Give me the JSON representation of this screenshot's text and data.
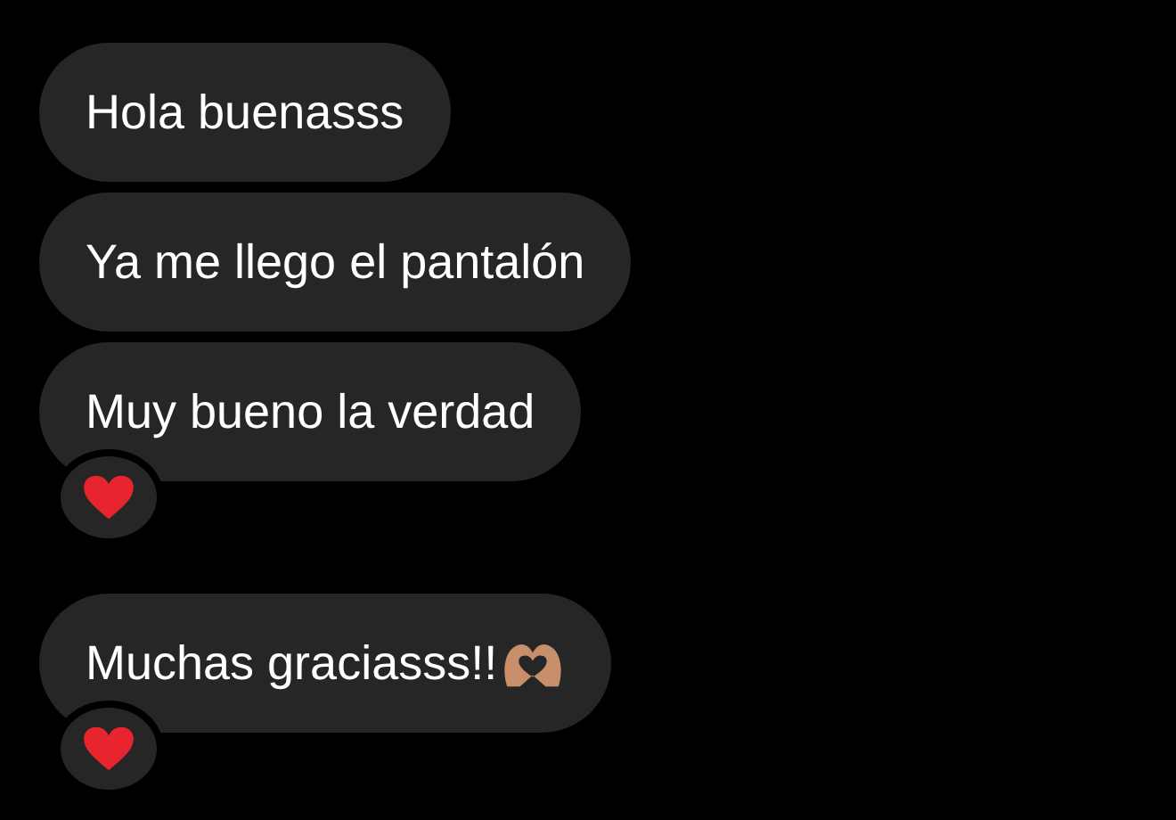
{
  "messages": [
    {
      "text": "Hola buenasss",
      "reacted": false,
      "heart_hands": false
    },
    {
      "text": "Ya me llego el pantalón",
      "reacted": false,
      "heart_hands": false
    },
    {
      "text": "Muy bueno la verdad",
      "reacted": true,
      "heart_hands": false
    },
    {
      "text": "Muchas graciasss!!",
      "reacted": true,
      "heart_hands": true
    }
  ]
}
